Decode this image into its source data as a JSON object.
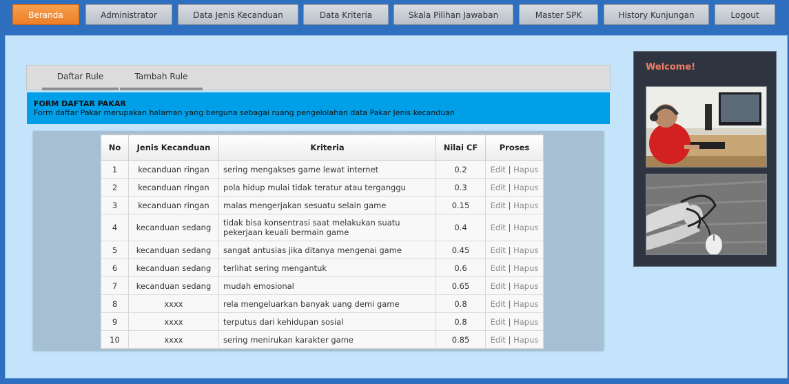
{
  "nav": [
    {
      "label": "Beranda",
      "active": true
    },
    {
      "label": "Administrator"
    },
    {
      "label": "Data Jenis Kecanduan"
    },
    {
      "label": "Data Kriteria"
    },
    {
      "label": "Skala Pilihan Jawaban"
    },
    {
      "label": "Master SPK"
    },
    {
      "label": "History Kunjungan"
    },
    {
      "label": "Logout"
    }
  ],
  "tabs": [
    {
      "label": "Daftar Rule"
    },
    {
      "label": "Tambah Rule"
    }
  ],
  "banner": {
    "title": "FORM DAFTAR PAKAR",
    "desc": "Form daftar Pakar merupakan halaman yang berguna sebagai ruang pengelolahan data Pakar Jenis kecanduan"
  },
  "table": {
    "headers": [
      "No",
      "Jenis Kecanduan",
      "Kriteria",
      "Nilai CF",
      "Proses"
    ],
    "edit_label": "Edit",
    "separator": "|",
    "delete_label": "Hapus",
    "rows": [
      {
        "no": "1",
        "jenis": "kecanduan ringan",
        "kriteria": "sering mengakses game lewat internet",
        "cf": "0.2"
      },
      {
        "no": "2",
        "jenis": "kecanduan ringan",
        "kriteria": "pola hidup mulai tidak teratur atau terganggu",
        "cf": "0.3"
      },
      {
        "no": "3",
        "jenis": "kecanduan ringan",
        "kriteria": "malas mengerjakan sesuatu selain game",
        "cf": "0.15"
      },
      {
        "no": "4",
        "jenis": "kecanduan sedang",
        "kriteria": "tidak bisa konsentrasi saat melakukan suatu pekerjaan keuali bermain game",
        "cf": "0.4"
      },
      {
        "no": "5",
        "jenis": "kecanduan sedang",
        "kriteria": "sangat antusias jika ditanya mengenai game",
        "cf": "0.45"
      },
      {
        "no": "6",
        "jenis": "kecanduan sedang",
        "kriteria": "terlihat sering mengantuk",
        "cf": "0.6"
      },
      {
        "no": "7",
        "jenis": "kecanduan sedang",
        "kriteria": "mudah emosional",
        "cf": "0.65"
      },
      {
        "no": "8",
        "jenis": "xxxx",
        "kriteria": "rela mengeluarkan banyak uang demi game",
        "cf": "0.8"
      },
      {
        "no": "9",
        "jenis": "xxxx",
        "kriteria": "terputus dari kehidupan sosial",
        "cf": "0.8"
      },
      {
        "no": "10",
        "jenis": "xxxx",
        "kriteria": "sering menirukan karakter game",
        "cf": "0.85"
      }
    ]
  },
  "sidebar": {
    "welcome": "Welcome!"
  }
}
